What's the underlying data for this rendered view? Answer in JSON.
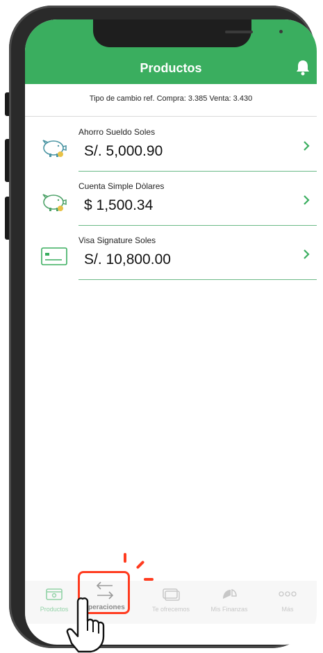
{
  "header": {
    "title": "Productos"
  },
  "exchange": {
    "text": "Tipo de cambio ref. Compra: 3.385 Venta: 3.430"
  },
  "products": [
    {
      "name": "Ahorro Sueldo Soles",
      "amount": "S/. 5,000.90",
      "icon": "piggy-bank-icon"
    },
    {
      "name": "Cuenta Simple Dòlares",
      "amount": "$ 1,500.34",
      "icon": "piggy-bank-icon"
    },
    {
      "name": "Visa Signature Soles",
      "amount": "S/. 10,800.00",
      "icon": "credit-card-icon"
    }
  ],
  "tabs": [
    {
      "label": "Productos",
      "icon": "wallet-icon"
    },
    {
      "label": "Operaciones",
      "icon": "transfer-arrows-icon"
    },
    {
      "label": "Te ofrecemos",
      "icon": "card-offer-icon"
    },
    {
      "label": "Mis Finanzas",
      "icon": "chart-icon"
    },
    {
      "label": "Más",
      "icon": "more-dots-icon"
    }
  ],
  "colors": {
    "brand": "#3aae5f",
    "divider": "#6ab986",
    "highlight": "#ff3b1f",
    "chevron": "#3aae5f"
  }
}
